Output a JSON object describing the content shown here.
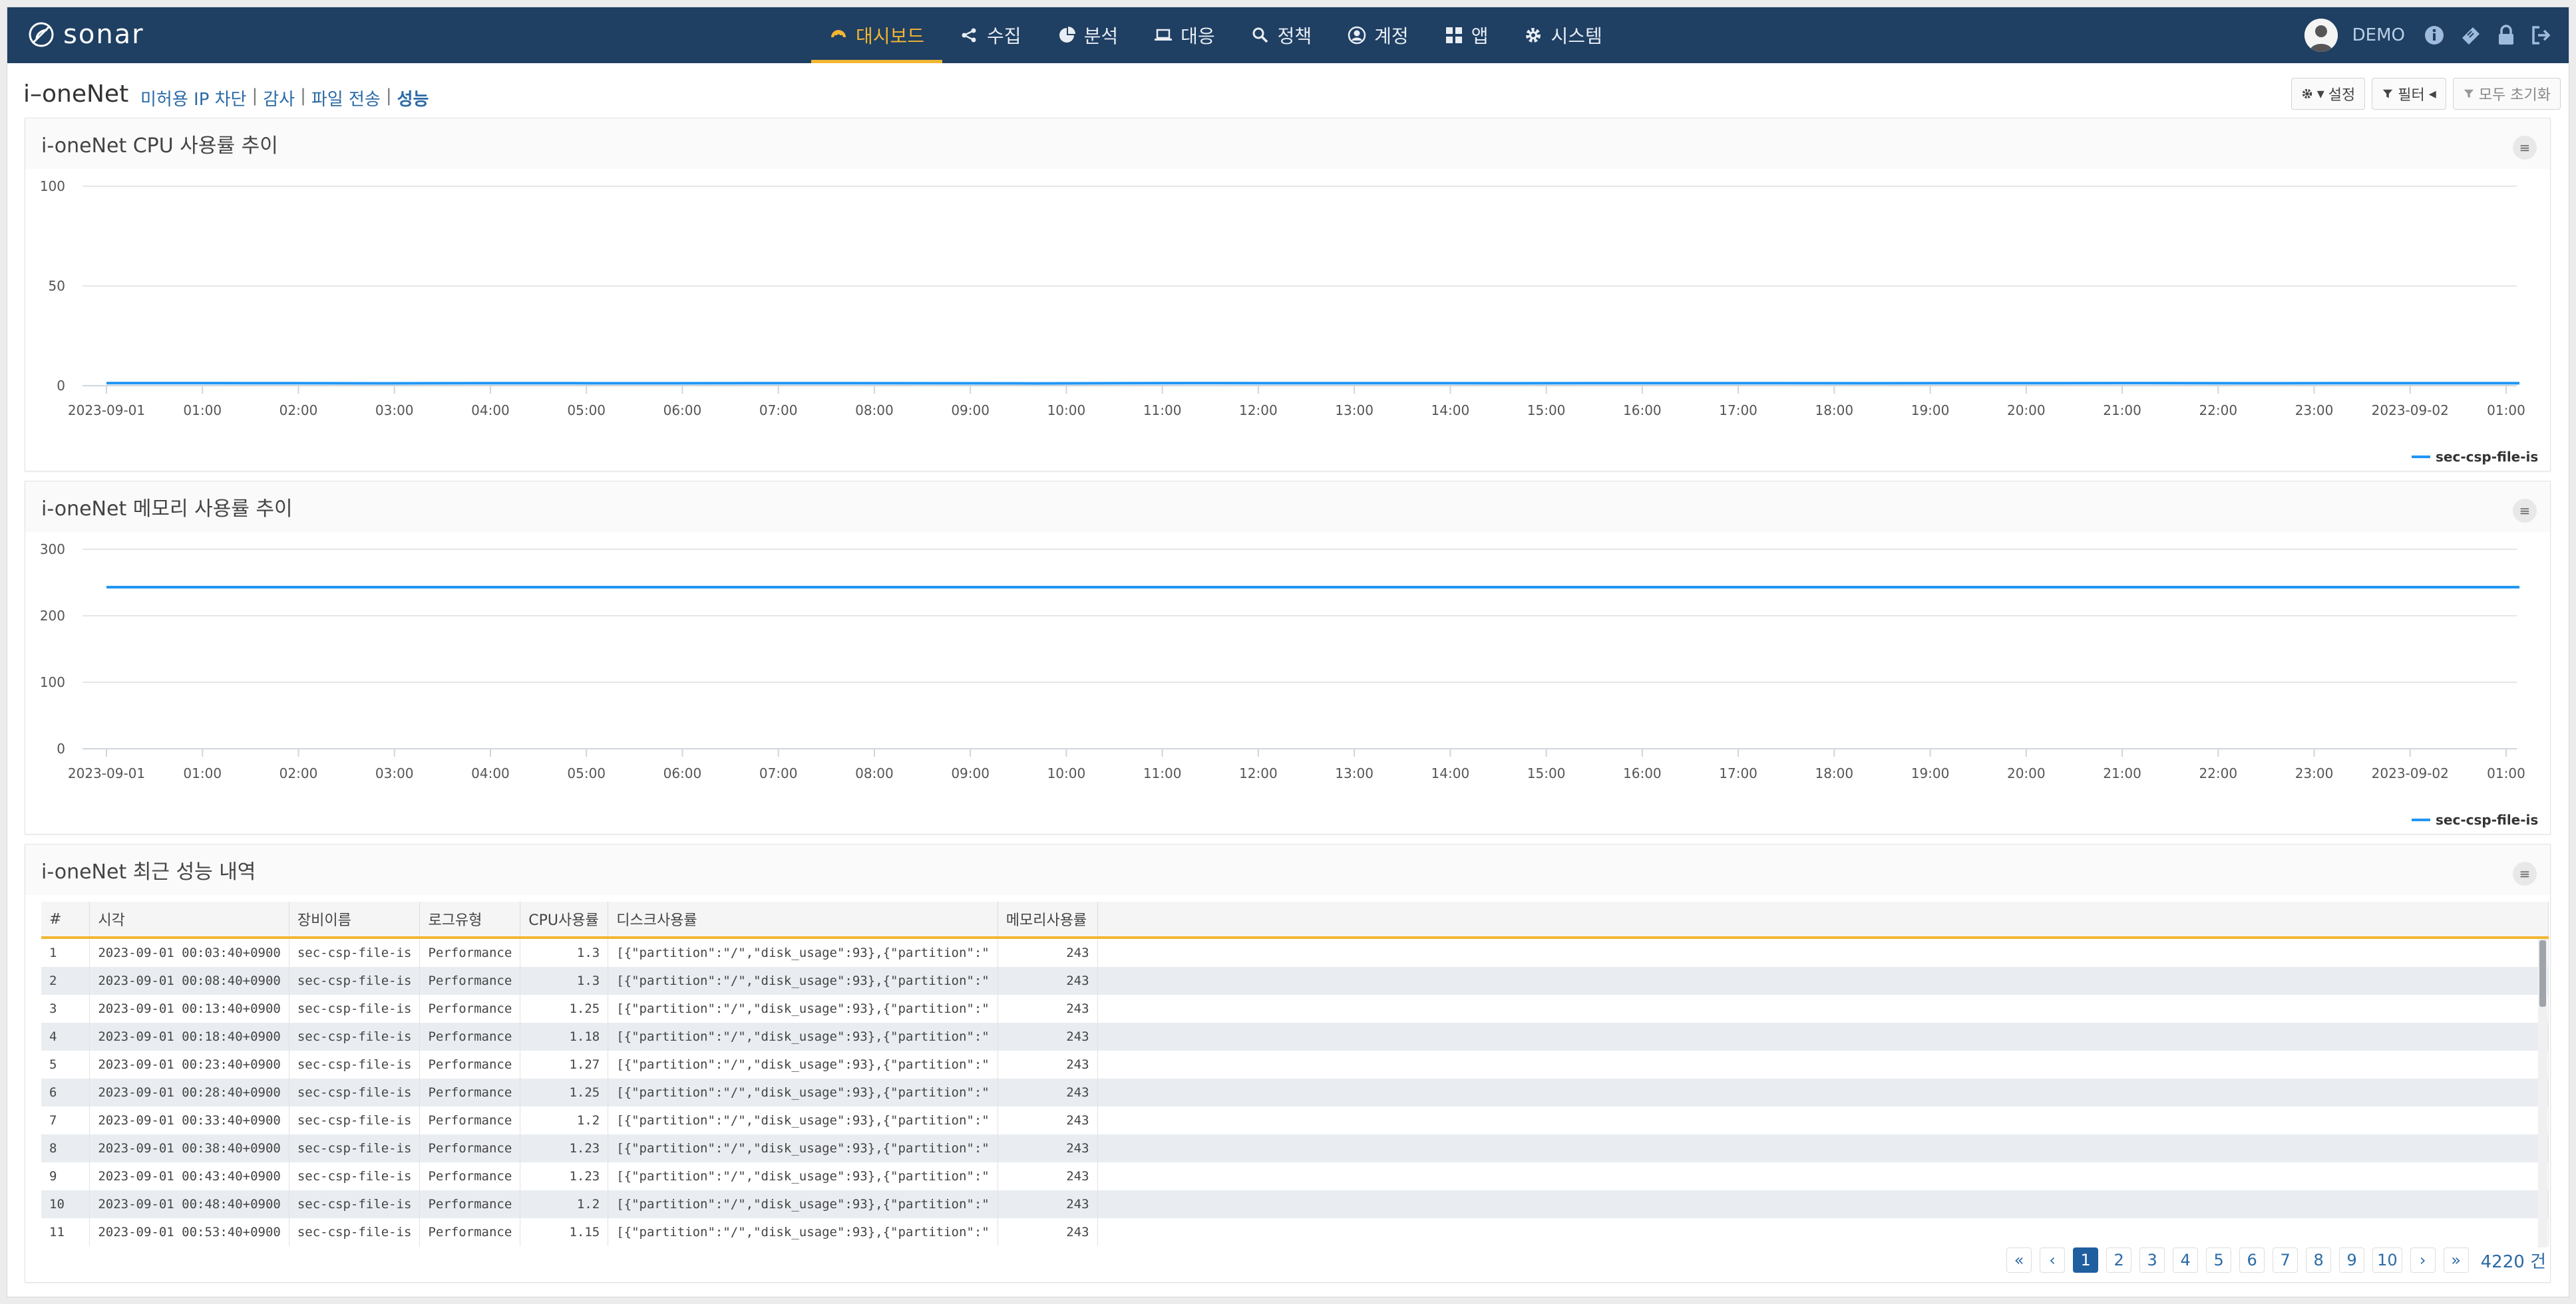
{
  "app": {
    "logo_text": "sonar"
  },
  "nav": {
    "items": [
      {
        "label": "대시보드",
        "icon": "dashboard-icon",
        "active": true
      },
      {
        "label": "수집",
        "icon": "share-icon",
        "active": false
      },
      {
        "label": "분석",
        "icon": "pie-chart-icon",
        "active": false
      },
      {
        "label": "대응",
        "icon": "laptop-icon",
        "active": false
      },
      {
        "label": "정책",
        "icon": "search-icon",
        "active": false
      },
      {
        "label": "계정",
        "icon": "user-circle-icon",
        "active": false
      },
      {
        "label": "앱",
        "icon": "grid-icon",
        "active": false
      },
      {
        "label": "시스템",
        "icon": "gear-icon",
        "active": false
      }
    ],
    "user": "DEMO"
  },
  "subheader": {
    "title": "i–oneNet",
    "links": [
      "미허용 IP 차단",
      "감사",
      "파일 전송",
      "성능"
    ],
    "settings_label": "설정",
    "filter_label": "필터",
    "reset_label": "모두 초기화"
  },
  "cpu_panel": {
    "title": "i-oneNet CPU 사용률 추이",
    "chart_data": {
      "type": "line",
      "x_ticks": [
        "2023-09-01",
        "01:00",
        "02:00",
        "03:00",
        "04:00",
        "05:00",
        "06:00",
        "07:00",
        "08:00",
        "09:00",
        "10:00",
        "11:00",
        "12:00",
        "13:00",
        "14:00",
        "15:00",
        "16:00",
        "17:00",
        "18:00",
        "19:00",
        "20:00",
        "21:00",
        "22:00",
        "23:00",
        "2023-09-02",
        "01:00"
      ],
      "y_ticks": [
        "0",
        "50",
        "100"
      ],
      "ylim": [
        0,
        100
      ],
      "series": [
        {
          "name": "sec-csp-file-is",
          "values": [
            1.3,
            1.3,
            1.25,
            1.18,
            1.27,
            1.25,
            1.2,
            1.23,
            1.23,
            1.2,
            1.15,
            1.25,
            1.3,
            1.22,
            1.27,
            1.2,
            1.25,
            1.28,
            1.22,
            1.2,
            1.26,
            1.24,
            1.3,
            1.21,
            1.23,
            1.27,
            1.25
          ],
          "color": "#2196f3"
        }
      ],
      "legend": "bottom-right"
    }
  },
  "mem_panel": {
    "title": "i-oneNet 메모리 사용률 추이",
    "chart_data": {
      "type": "line",
      "x_ticks": [
        "2023-09-01",
        "01:00",
        "02:00",
        "03:00",
        "04:00",
        "05:00",
        "06:00",
        "07:00",
        "08:00",
        "09:00",
        "10:00",
        "11:00",
        "12:00",
        "13:00",
        "14:00",
        "15:00",
        "16:00",
        "17:00",
        "18:00",
        "19:00",
        "20:00",
        "21:00",
        "22:00",
        "23:00",
        "2023-09-02",
        "01:00"
      ],
      "y_ticks": [
        "0",
        "100",
        "200",
        "300"
      ],
      "ylim": [
        0,
        300
      ],
      "series": [
        {
          "name": "sec-csp-file-is",
          "values": [
            243,
            243,
            243,
            243,
            243,
            243,
            243,
            243,
            243,
            243,
            243,
            243,
            243,
            243,
            243,
            243,
            243,
            243,
            243,
            243,
            243,
            243,
            243,
            243,
            243,
            243,
            243
          ],
          "color": "#2196f3"
        }
      ],
      "legend": "bottom-right"
    }
  },
  "table_panel": {
    "title": "i-oneNet 최근 성능 내역",
    "columns": [
      "#",
      "시각",
      "장비이름",
      "로그유형",
      "CPU사용률",
      "디스크사용률",
      "메모리사용률"
    ],
    "rows": [
      [
        "1",
        "2023-09-01 00:03:40+0900",
        "sec-csp-file-is",
        "Performance",
        "1.3",
        "[{\"partition\":\"/\",\"disk_usage\":93},{\"partition\":\"",
        "243"
      ],
      [
        "2",
        "2023-09-01 00:08:40+0900",
        "sec-csp-file-is",
        "Performance",
        "1.3",
        "[{\"partition\":\"/\",\"disk_usage\":93},{\"partition\":\"",
        "243"
      ],
      [
        "3",
        "2023-09-01 00:13:40+0900",
        "sec-csp-file-is",
        "Performance",
        "1.25",
        "[{\"partition\":\"/\",\"disk_usage\":93},{\"partition\":\"",
        "243"
      ],
      [
        "4",
        "2023-09-01 00:18:40+0900",
        "sec-csp-file-is",
        "Performance",
        "1.18",
        "[{\"partition\":\"/\",\"disk_usage\":93},{\"partition\":\"",
        "243"
      ],
      [
        "5",
        "2023-09-01 00:23:40+0900",
        "sec-csp-file-is",
        "Performance",
        "1.27",
        "[{\"partition\":\"/\",\"disk_usage\":93},{\"partition\":\"",
        "243"
      ],
      [
        "6",
        "2023-09-01 00:28:40+0900",
        "sec-csp-file-is",
        "Performance",
        "1.25",
        "[{\"partition\":\"/\",\"disk_usage\":93},{\"partition\":\"",
        "243"
      ],
      [
        "7",
        "2023-09-01 00:33:40+0900",
        "sec-csp-file-is",
        "Performance",
        "1.2",
        "[{\"partition\":\"/\",\"disk_usage\":93},{\"partition\":\"",
        "243"
      ],
      [
        "8",
        "2023-09-01 00:38:40+0900",
        "sec-csp-file-is",
        "Performance",
        "1.23",
        "[{\"partition\":\"/\",\"disk_usage\":93},{\"partition\":\"",
        "243"
      ],
      [
        "9",
        "2023-09-01 00:43:40+0900",
        "sec-csp-file-is",
        "Performance",
        "1.23",
        "[{\"partition\":\"/\",\"disk_usage\":93},{\"partition\":\"",
        "243"
      ],
      [
        "10",
        "2023-09-01 00:48:40+0900",
        "sec-csp-file-is",
        "Performance",
        "1.2",
        "[{\"partition\":\"/\",\"disk_usage\":93},{\"partition\":\"",
        "243"
      ],
      [
        "11",
        "2023-09-01 00:53:40+0900",
        "sec-csp-file-is",
        "Performance",
        "1.15",
        "[{\"partition\":\"/\",\"disk_usage\":93},{\"partition\":\"",
        "243"
      ]
    ]
  },
  "pagination": {
    "first": "«",
    "prev": "‹",
    "next": "›",
    "last": "»",
    "pages": [
      "1",
      "2",
      "3",
      "4",
      "5",
      "6",
      "7",
      "8",
      "9",
      "10"
    ],
    "current": "1",
    "total": "4220 건"
  },
  "colors": {
    "navbar": "#1f3f63",
    "accent": "#f2b632",
    "series": "#2196f3",
    "link": "#2b6aa6"
  }
}
